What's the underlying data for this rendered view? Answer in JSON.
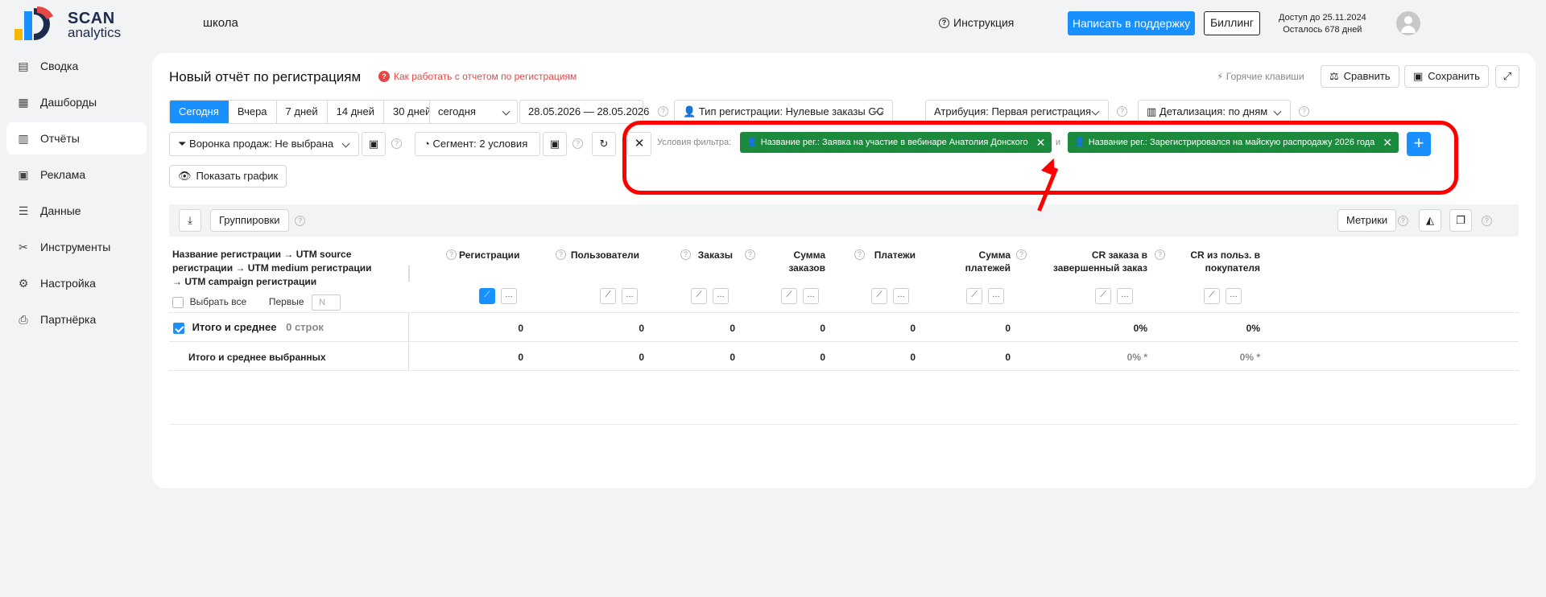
{
  "header": {
    "logo_line1": "SCAN",
    "logo_line2": "analytics",
    "project": "школа",
    "help": "Инструкция",
    "support": "Написать в поддержку",
    "billing": "Биллинг",
    "access_until": "Доступ до 25.11.2024",
    "days_left": "Осталось 678 дней"
  },
  "sidebar": {
    "items": [
      {
        "label": "Сводка",
        "icon": "summary-icon"
      },
      {
        "label": "Дашборды",
        "icon": "dashboard-icon"
      },
      {
        "label": "Отчёты",
        "icon": "reports-icon",
        "active": true
      },
      {
        "label": "Реклама",
        "icon": "ads-icon"
      },
      {
        "label": "Данные",
        "icon": "database-icon"
      },
      {
        "label": "Инструменты",
        "icon": "tools-icon"
      },
      {
        "label": "Настройка",
        "icon": "gear-icon"
      },
      {
        "label": "Партнёрка",
        "icon": "partner-icon"
      }
    ]
  },
  "report": {
    "title": "Новый отчёт по регистрациям",
    "howto": "Как работать с отчетом по регистрациям",
    "hotkeys": "Горячие клавиши",
    "compare": "Сравнить",
    "save": "Сохранить",
    "periods": [
      "Сегодня",
      "Вчера",
      "7 дней",
      "14 дней",
      "30 дней"
    ],
    "period_select": "сегодня",
    "date_from": "28.05.2026",
    "date_sep": "—",
    "date_to": "28.05.2026",
    "reg_type": "Тип регистрации: Нулевые заказы GC",
    "attribution": "Атрибуция: Первая регистрация",
    "detail": "Детализация:  по дням",
    "funnel": "Воронка продаж: Не выбрана",
    "segment": "Сегмент: 2 условия",
    "filter_label": "Условия фильтра:",
    "chip1": "Название рег.: Заявка на участие в вебинаре Анатолия Донского",
    "chip_and": "и",
    "chip2": "Название рег.: Зарегистрировался на майскую распродажу 2026 года",
    "show_chart": "Показать график",
    "groupings": "Группировки",
    "metrics": "Метрики"
  },
  "table": {
    "dim_header": "Название регистрации → UTM source регистрации → UTM medium регистрации → UTM campaign регистрации",
    "select_all": "Выбрать все",
    "first": "Первые",
    "first_placeholder": "N",
    "columns": [
      "Регистрации",
      "Пользователи",
      "Заказы",
      "Сумма заказов",
      "Платежи",
      "Сумма платежей",
      "CR заказа в завершенный заказ",
      "CR из польз. в покупателя"
    ],
    "total_label": "Итого и среднее",
    "total_rows": "0 строк",
    "total_values": [
      "0",
      "0",
      "0",
      "0",
      "0",
      "0",
      "0%",
      "0%"
    ],
    "selected_label": "Итого и среднее выбранных",
    "selected_values": [
      "0",
      "0",
      "0",
      "0",
      "0",
      "0",
      "0% *",
      "0% *"
    ]
  }
}
